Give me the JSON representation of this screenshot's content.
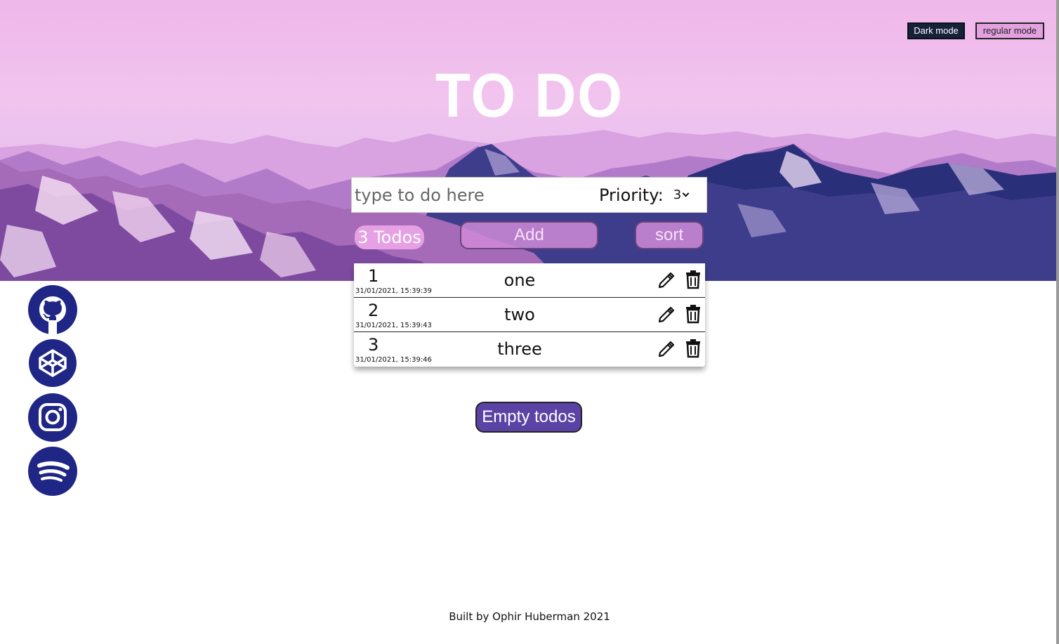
{
  "header": {
    "title": "TO DO",
    "dark_mode_label": "Dark mode",
    "regular_mode_label": "regular mode"
  },
  "form": {
    "input_placeholder": "type to do here",
    "priority_label": "Priority:",
    "priority_value": "3",
    "counter_text": "3 Todos",
    "add_label": "Add",
    "sort_label": "sort"
  },
  "todos": [
    {
      "priority": "1",
      "created": "31/01/2021, 15:39:39",
      "text": "one"
    },
    {
      "priority": "2",
      "created": "31/01/2021, 15:39:43",
      "text": "two"
    },
    {
      "priority": "3",
      "created": "31/01/2021, 15:39:46",
      "text": "three"
    }
  ],
  "empty_label": "Empty todos",
  "social": [
    "github-icon",
    "codepen-icon",
    "instagram-icon",
    "spotify-icon"
  ],
  "footer": "Built by Ophir Huberman 2021",
  "colors": {
    "sky": "#efb7ea",
    "mountain_dark": "#2a2f7a",
    "mountain_mid": "#8f5fb2",
    "snow": "#f6e6f6",
    "accent": "#e6a1e4",
    "button_empty": "#5b43a6",
    "social_bg": "#1f2685"
  }
}
